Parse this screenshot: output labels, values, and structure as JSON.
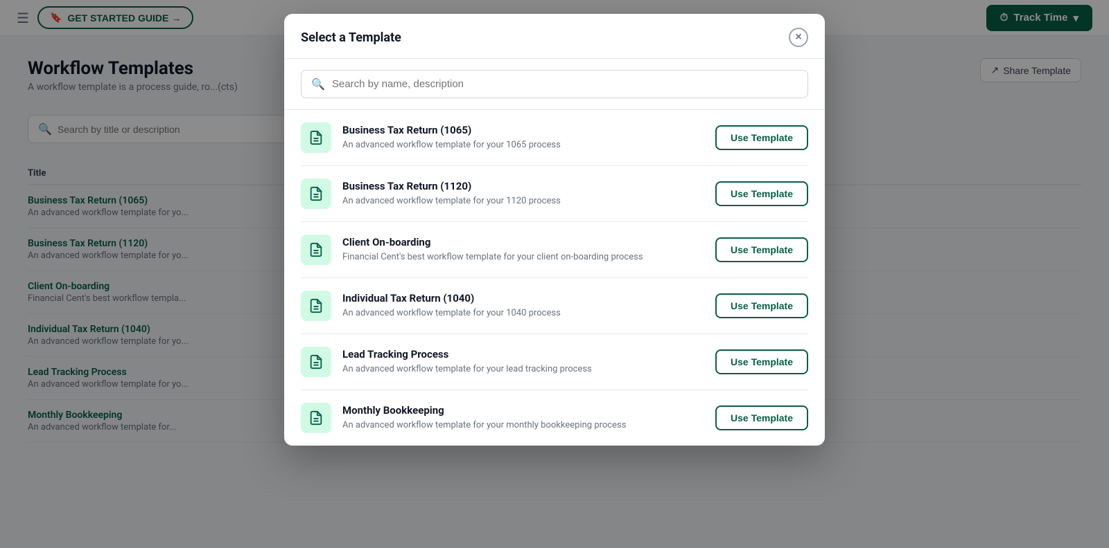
{
  "topBar": {
    "hamburger": "☰",
    "getStarted": "GET STARTED GUIDE →",
    "trackTime": "Track Time",
    "chevron": "▾"
  },
  "page": {
    "title": "Workflow Templates",
    "subtitle": "A workflow template is a process guide, ro...",
    "searchPlaceholder": "Search by title or description",
    "shareLabel": "Share Template",
    "tableColumn": "Title"
  },
  "bgRows": [
    {
      "title": "Business Tax Return (1065)",
      "desc": "An advanced workflow template for yo..."
    },
    {
      "title": "Business Tax Return (1120)",
      "desc": "An advanced workflow template for yo..."
    },
    {
      "title": "Client On-boarding",
      "desc": "Financial Cent's best workflow templa..."
    },
    {
      "title": "Individual Tax Return (1040)",
      "desc": "An advanced workflow template for yo..."
    },
    {
      "title": "Lead Tracking Process",
      "desc": "An advanced workflow template for yo..."
    },
    {
      "title": "Monthly Bookkeeping",
      "desc": "An advanced workflow template for..."
    }
  ],
  "modal": {
    "title": "Select a Template",
    "searchPlaceholder": "Search by name, description",
    "closeLabel": "×",
    "useTemplateLabel": "Use Template",
    "templates": [
      {
        "name": "Business Tax Return (1065)",
        "desc": "An advanced workflow template for your 1065 process"
      },
      {
        "name": "Business Tax Return (1120)",
        "desc": "An advanced workflow template for your 1120 process"
      },
      {
        "name": "Client On-boarding",
        "desc": "Financial Cent's best workflow template for your client on-boarding process"
      },
      {
        "name": "Individual Tax Return (1040)",
        "desc": "An advanced workflow template for your 1040 process"
      },
      {
        "name": "Lead Tracking Process",
        "desc": "An advanced workflow template for your lead tracking process"
      },
      {
        "name": "Monthly Bookkeeping",
        "desc": "An advanced workflow template for your monthly bookkeeping process"
      }
    ]
  },
  "colors": {
    "brand": "#065f46",
    "brandLight": "#d1fae5"
  }
}
